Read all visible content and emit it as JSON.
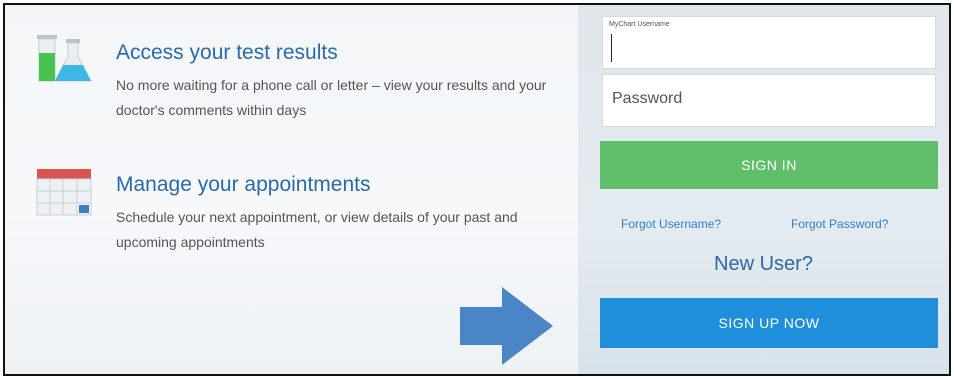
{
  "features": [
    {
      "icon": "lab-flasks-icon",
      "title": "Access your test results",
      "description": "No more waiting for a phone call or letter – view your results and your doctor's comments within days"
    },
    {
      "icon": "calendar-icon",
      "title": "Manage your appointments",
      "description": "Schedule your next appointment, or view details of your past and upcoming appointments"
    }
  ],
  "login": {
    "username_label": "MyChart Username",
    "username_value": "",
    "password_placeholder": "Password",
    "signin_label": "SIGN IN",
    "forgot_username": "Forgot Username?",
    "forgot_password": "Forgot Password?",
    "new_user_text": "New User?",
    "signup_label": "SIGN UP NOW"
  },
  "decor": {
    "arrow_icon": "right-arrow-icon"
  },
  "colors": {
    "title_blue": "#2a6aa8",
    "link_blue": "#2f7fd0",
    "signin_green": "#5fbf6a",
    "signup_blue": "#1f8fdc",
    "arrow_blue": "#4a86c5"
  }
}
